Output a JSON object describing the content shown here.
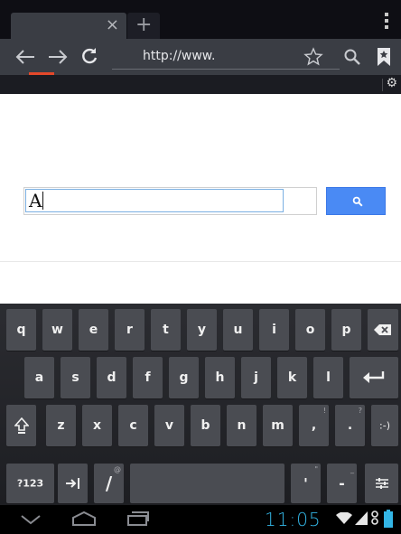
{
  "tabs": [
    {
      "title": "",
      "close_glyph": "×"
    },
    {
      "new_tab_glyph": "+"
    }
  ],
  "toolbar": {
    "back_icon": "back-arrow-icon",
    "forward_icon": "forward-arrow-icon",
    "reload_icon": "reload-icon",
    "url": "http://www.",
    "bookmark_star_icon": "star-icon",
    "search_icon": "search-icon",
    "bookmarks_icon": "bookmarks-icon",
    "menu_icon": "overflow-menu-icon"
  },
  "page": {
    "search_text": "A",
    "search_button_icon": "search-icon"
  },
  "keyboard": {
    "row1": [
      "q",
      "w",
      "e",
      "r",
      "t",
      "y",
      "u",
      "i",
      "o",
      "p"
    ],
    "row2": [
      "a",
      "s",
      "d",
      "f",
      "g",
      "h",
      "j",
      "k",
      "l"
    ],
    "row3": [
      "z",
      "x",
      "c",
      "v",
      "b",
      "n",
      "m",
      ",",
      "."
    ],
    "row3_hints": [
      "",
      "",
      "",
      "",
      "",
      "",
      "",
      "!",
      "?"
    ],
    "smiley": ":-)",
    "symbols": "?123",
    "slash": "/",
    "slash_hint": "@",
    "apostrophe": "'",
    "apostrophe_hint": "\"",
    "dash": "-",
    "dash_hint": "_"
  },
  "status": {
    "time": "11:05",
    "accent": "#33b5e5"
  },
  "colors": {
    "search_button": "#4a8af4",
    "progress": "#e4482a"
  }
}
